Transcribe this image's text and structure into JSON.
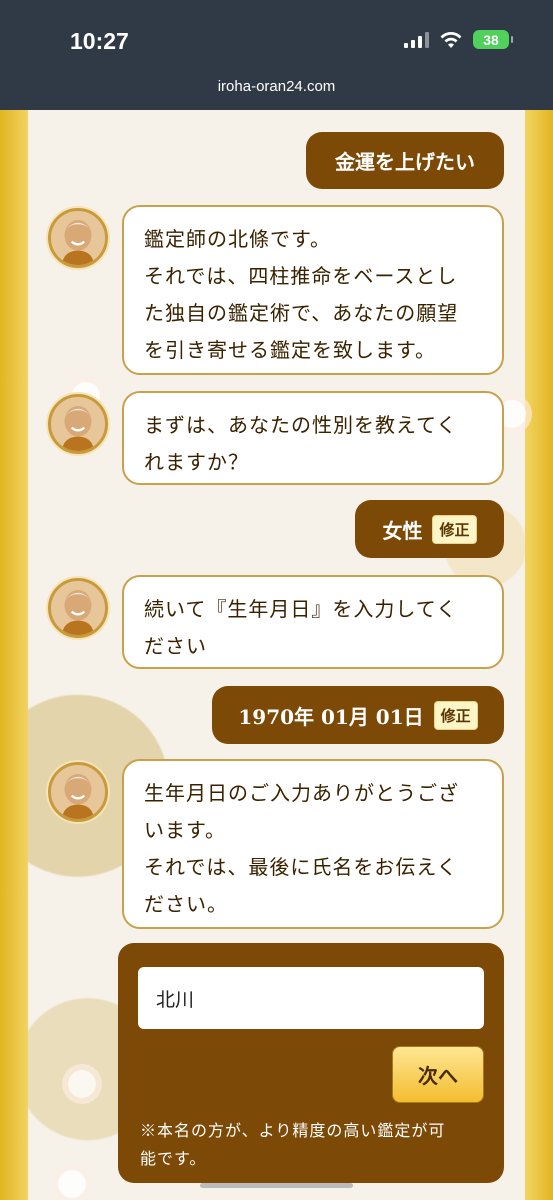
{
  "status_bar": {
    "time": "10:27",
    "battery": "38",
    "url": "iroha-oran24.com"
  },
  "chat": {
    "user_wish": "金運を上げたい",
    "bot_intro": [
      "鑑定師の北條です。",
      "それでは、四柱推命をベースとし",
      "た独自の鑑定術で、あなたの願望",
      "を引き寄せる鑑定を致します。"
    ],
    "bot_ask_gender": [
      "まずは、あなたの性別を教えてく",
      "れますか？"
    ],
    "user_gender": "女性",
    "bot_ask_birthday": [
      "続いて『生年月日』を入力してく",
      "ださい"
    ],
    "user_birthday": "1970年 01月 01日",
    "bot_ask_name": [
      "生年月日のご入力ありがとうござ",
      "います。",
      "それでは、最後に氏名をお伝えく",
      "ださい。"
    ],
    "edit_label": "修正"
  },
  "form": {
    "name_value": "北川",
    "next_label": "次へ",
    "note_lines": [
      "※本名の方が、より精度の高い鑑定が可",
      "能です。"
    ]
  },
  "colors": {
    "accent_brown": "#7c4a06",
    "bubble_border": "#c7a14c",
    "gold": "#e9c53a"
  }
}
